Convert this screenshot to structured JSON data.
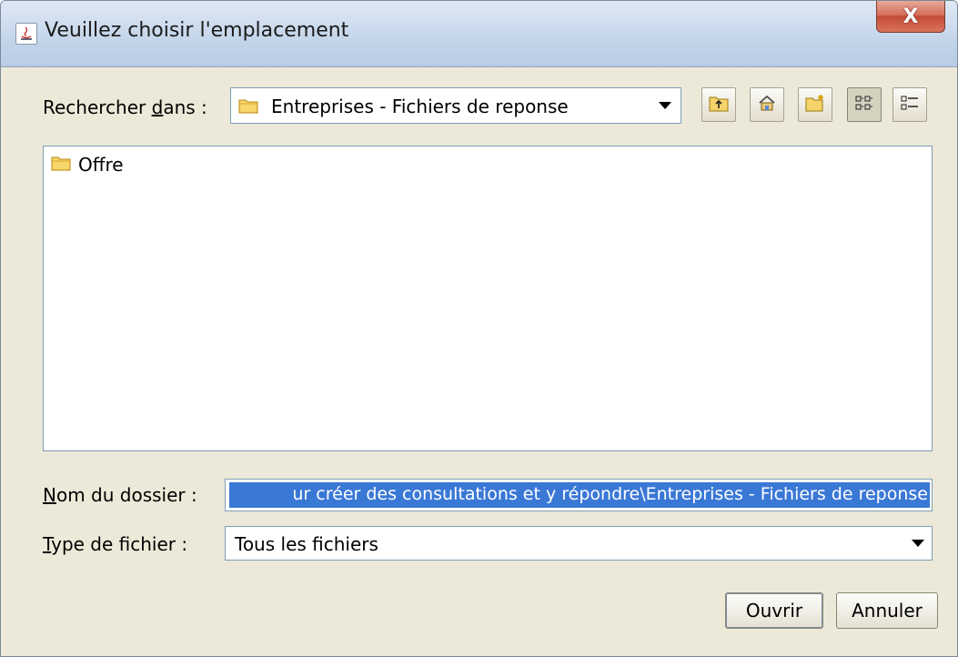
{
  "window": {
    "title": "Veuillez choisir l'emplacement",
    "close_glyph": "X"
  },
  "look_in": {
    "label_prefix": "Rechercher ",
    "label_mnemonic": "d",
    "label_suffix": "ans :",
    "value": "Entreprises - Fichiers de reponse"
  },
  "toolbar": {
    "buttons": [
      {
        "name": "up-folder-icon"
      },
      {
        "name": "home-icon"
      },
      {
        "name": "new-folder-icon"
      },
      {
        "name": "list-view-icon",
        "pressed": true
      },
      {
        "name": "details-view-icon"
      }
    ]
  },
  "files": [
    {
      "name": "Offre",
      "icon": "folder-icon"
    }
  ],
  "folder_name": {
    "label_mnemonic": "N",
    "label_rest": "om du dossier :",
    "value": "ur créer des consultations et y répondre\\Entreprises - Fichiers de reponse"
  },
  "file_type": {
    "label_mnemonic": "T",
    "label_rest": "ype de fichier :",
    "value": "Tous les fichiers"
  },
  "actions": {
    "open_label": "Ouvrir",
    "cancel_label": "Annuler"
  },
  "colors": {
    "selection": "#3a78d6",
    "dialog_bg": "#ece9d8",
    "close_button": "#c24c35"
  }
}
